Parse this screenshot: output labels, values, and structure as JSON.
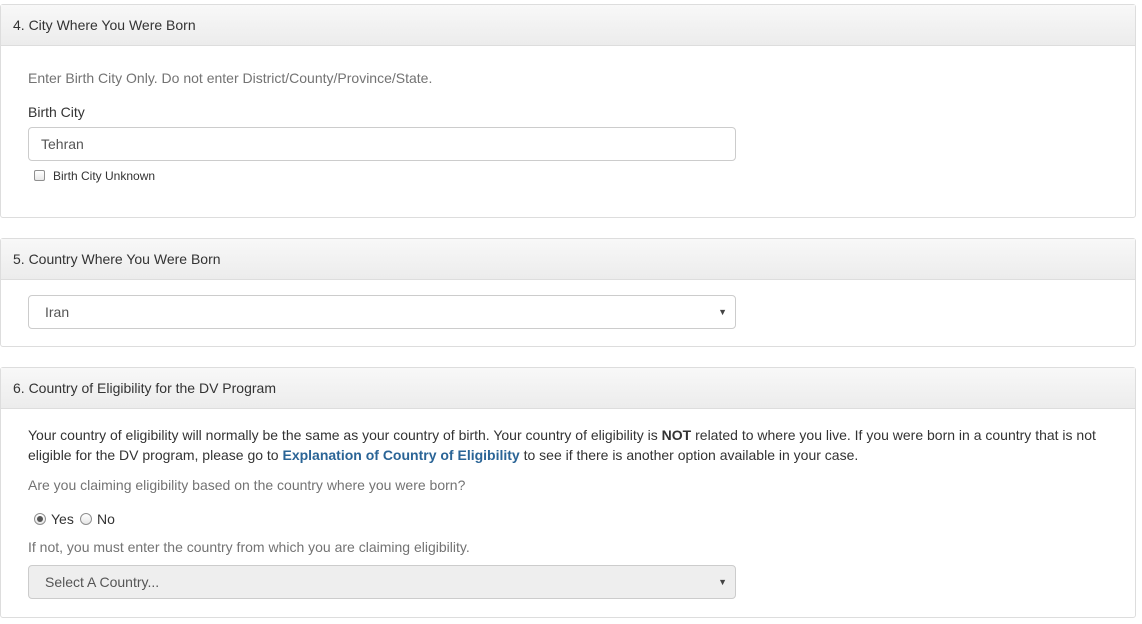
{
  "section4": {
    "title": "4. City Where You Were Born",
    "instructions": "Enter Birth City Only. Do not enter District/County/Province/State.",
    "field_label": "Birth City",
    "field_value": "Tehran",
    "unknown_label": "Birth City Unknown"
  },
  "section5": {
    "title": "5. Country Where You Were Born",
    "selected_country": "Iran"
  },
  "section6": {
    "title": "6. Country of Eligibility for the DV Program",
    "para_part1": "Your country of eligibility will normally be the same as your country of birth. Your country of eligibility is ",
    "para_not": "NOT",
    "para_part2": " related to where you live. If you were born in a country that is not eligible for the DV program, please go to ",
    "para_link": "Explanation of Country of Eligibility",
    "para_part3": " to see if there is another option available in your case.",
    "question": "Are you claiming eligibility based on the country where you were born?",
    "yes_label": "Yes",
    "no_label": "No",
    "selected_option": "Yes",
    "note": "If not, you must enter the country from which you are claiming eligibility.",
    "select_placeholder": "Select A Country..."
  },
  "icons": {
    "dropdown": "▼"
  }
}
